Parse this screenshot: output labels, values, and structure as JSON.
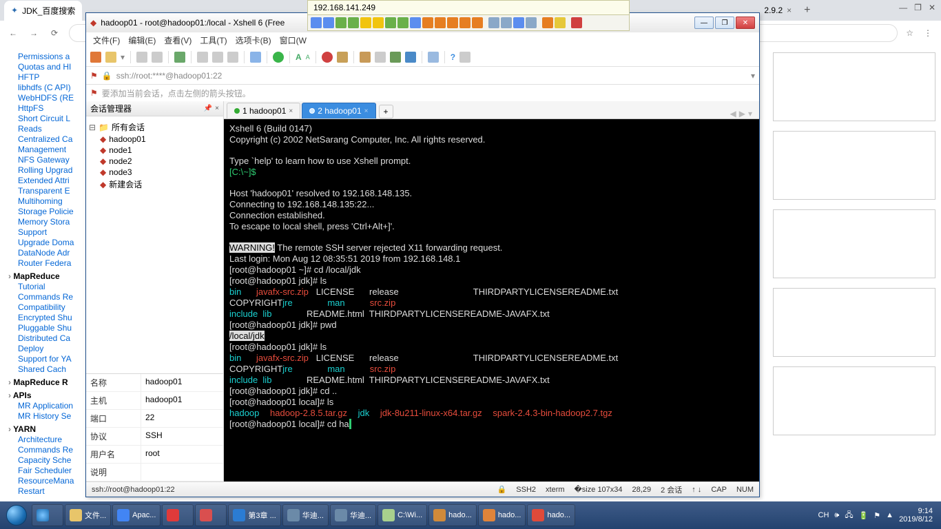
{
  "browser": {
    "tabs": [
      {
        "label": "JDK_百度搜索"
      },
      {
        "label": "2.9.2"
      }
    ],
    "newtab": "+",
    "winmin": "—",
    "winmax": "❐",
    "winclose": "✕"
  },
  "ip_float": "192.168.141.249",
  "xshell": {
    "title": "hadoop01 - root@hadoop01:/local - Xshell 6 (Free",
    "menu": [
      "文件(F)",
      "编辑(E)",
      "查看(V)",
      "工具(T)",
      "选项卡(B)",
      "窗口(W"
    ],
    "addr": "ssh://root:****@hadoop01:22",
    "tip": "要添加当前会话，点击左侧的箭头按钮。",
    "session_mgr": "会话管理器",
    "tree_root": "所有会话",
    "tree": [
      "hadoop01",
      "node1",
      "node2",
      "node3",
      "新建会话"
    ],
    "props": {
      "name_k": "名称",
      "name_v": "hadoop01",
      "host_k": "主机",
      "host_v": "hadoop01",
      "port_k": "端口",
      "port_v": "22",
      "proto_k": "协议",
      "proto_v": "SSH",
      "user_k": "用户名",
      "user_v": "root",
      "desc_k": "说明",
      "desc_v": ""
    },
    "tabs": {
      "t1": "1 hadoop01",
      "t2": "2 hadoop01",
      "add": "+"
    },
    "status": {
      "conn": "ssh://root@hadoop01:22",
      "ssh": "SSH2",
      "term": "xterm",
      "size": "107x34",
      "pos": "28,29",
      "sess": "2 会话",
      "arrows": "↑  ↓",
      "cap": "CAP",
      "num": "NUM"
    }
  },
  "terminal": {
    "l1": "Xshell 6 (Build 0147)",
    "l2": "Copyright (c) 2002 NetSarang Computer, Inc. All rights reserved.",
    "l3": "Type `help' to learn how to use Xshell prompt.",
    "prompt_local": "[C:\\~]$",
    "l4": "Host 'hadoop01' resolved to 192.168.148.135.",
    "l5": "Connecting to 192.168.148.135:22...",
    "l6": "Connection established.",
    "l7": "To escape to local shell, press 'Ctrl+Alt+]'.",
    "warn": "WARNING!",
    "warn_txt": " The remote SSH server rejected X11 forwarding request.",
    "l8": "Last login: Mon Aug 12 08:35:51 2019 from 192.168.148.1",
    "p1": "[root@hadoop01 ~]# cd /local/jdk",
    "p2": "[root@hadoop01 jdk]# ls",
    "ls1a": "bin",
    "ls1b": "javafx-src.zip",
    "ls1c": "LICENSE",
    "ls1d": "release",
    "ls1e": "THIRDPARTYLICENSEREADME.txt",
    "ls2a": "COPYRIGHT",
    "ls2b": "jre",
    "ls2c": "man",
    "ls2d": "src.zip",
    "ls3a": "include",
    "ls3b": "lib",
    "ls3c": "README.html",
    "ls3d": "THIRDPARTYLICENSEREADME-JAVAFX.txt",
    "p3": "[root@hadoop01 jdk]# pwd",
    "pwd": "/local/jdk",
    "p4": "[root@hadoop01 jdk]# ls",
    "p5": "[root@hadoop01 jdk]# cd ..",
    "p6": "[root@hadoop01 local]# ls",
    "lo1": "hadoop",
    "lo2": "hadoop-2.8.5.tar.gz",
    "lo3": "jdk",
    "lo4": "jdk-8u211-linux-x64.tar.gz",
    "lo5": "spark-2.4.3-bin-hadoop2.7.tgz",
    "p7a": "[root@hadoop01 local]# cd ha",
    "p7b": " "
  },
  "sidebar": {
    "items1": [
      "Permissions a",
      "Quotas and HI",
      "HFTP",
      "libhdfs (C API)",
      "WebHDFS (RE",
      "HttpFS",
      "Short Circuit L",
      "  Reads",
      "Centralized Ca",
      "  Management",
      "NFS Gateway",
      "Rolling Upgrad",
      "Extended Attri",
      "Transparent E",
      "Multihoming",
      "Storage Policie",
      "Memory Stora",
      "  Support",
      "Upgrade Doma",
      "DataNode Adr",
      "Router Federa"
    ],
    "h1": "MapReduce",
    "items2": [
      "Tutorial",
      "Commands Re",
      "Compatibility ",
      "Encrypted Shu",
      "Pluggable Shu",
      "Distributed Ca",
      "  Deploy",
      "Support for YA",
      "  Shared Cach"
    ],
    "h2": "MapReduce R",
    "h2b": "APIs",
    "items3": [
      "MR Application",
      "MR History Se"
    ],
    "h3": "YARN",
    "items4": [
      "Architecture",
      "Commands Re",
      "Capacity Sche",
      "Fair Scheduler",
      "ResourceMana",
      "  Restart"
    ]
  },
  "taskbar": {
    "items": [
      {
        "label": "文件...",
        "color": "#e8c56a"
      },
      {
        "label": "Apac...",
        "color": "#4285f4"
      },
      {
        "label": "",
        "color": "#e03a3a"
      },
      {
        "label": "",
        "color": "#d94f4f"
      },
      {
        "label": "第3章 ...",
        "color": "#2b7cd3"
      },
      {
        "label": "华迪...",
        "color": "#6b8aa8"
      },
      {
        "label": "华迪...",
        "color": "#6b8aa8"
      },
      {
        "label": "C:\\Wi...",
        "color": "#a8d08d"
      },
      {
        "label": "hado...",
        "color": "#d08a3a"
      },
      {
        "label": "hado...",
        "color": "#e0843a"
      },
      {
        "label": "hado...",
        "color": "#e04a3a"
      }
    ],
    "ime": "CH",
    "time": "9:14",
    "date": "2019/8/12"
  }
}
